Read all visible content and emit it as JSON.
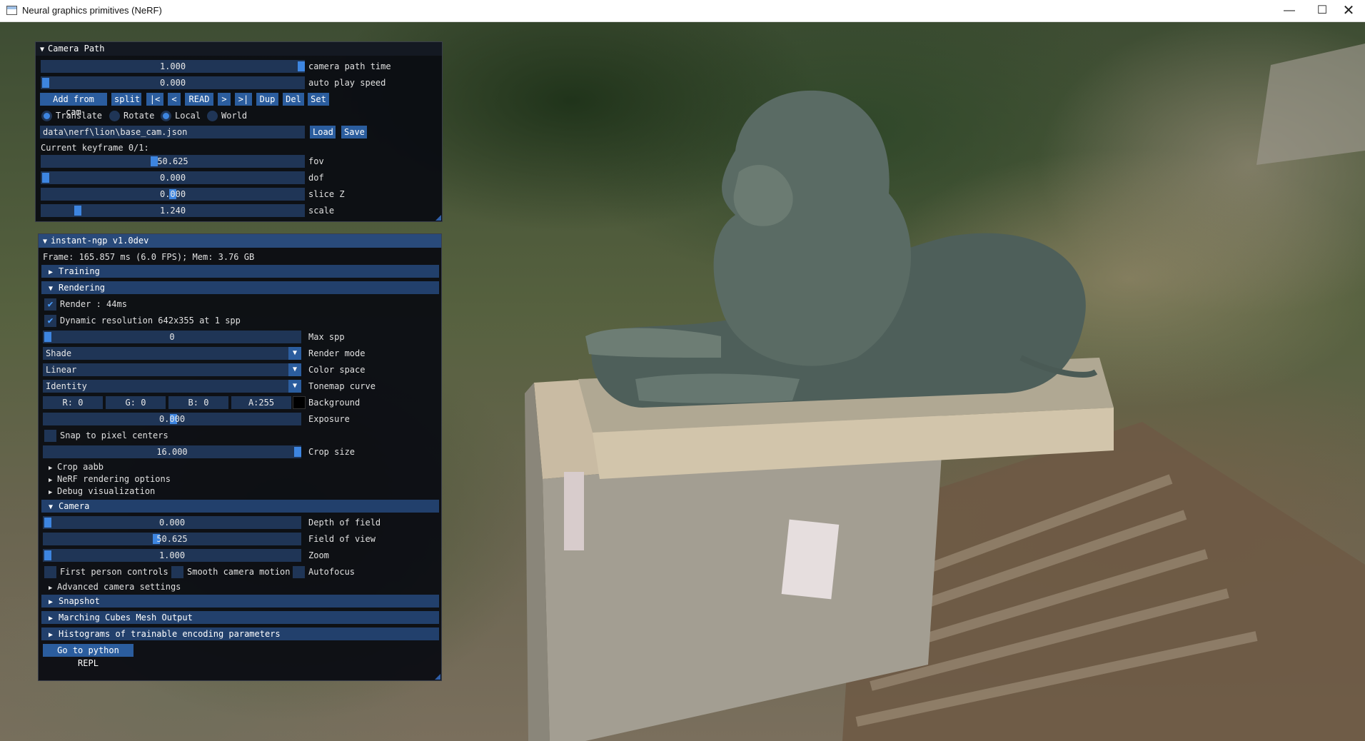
{
  "window": {
    "title": "Neural graphics primitives (NeRF)",
    "minimize": "—",
    "maximize": "☐",
    "close": "✕"
  },
  "camera_path": {
    "title": "Camera Path",
    "path_time": {
      "value": "1.000",
      "label": "camera path time",
      "fraction": 1.0
    },
    "play_speed": {
      "value": "0.000",
      "label": "auto play speed",
      "fraction": 0.0
    },
    "buttons": [
      "Add from cam",
      "split",
      "|<",
      "<",
      "READ",
      ">",
      ">|",
      "Dup",
      "Del",
      "Set"
    ],
    "radios": [
      {
        "label": "Translate",
        "selected": true
      },
      {
        "label": "Rotate",
        "selected": false
      },
      {
        "label": "Local",
        "selected": true
      },
      {
        "label": "World",
        "selected": false
      }
    ],
    "file_path": "data\\nerf\\lion\\base_cam.json",
    "load_label": "Load",
    "save_label": "Save",
    "keyframe_text": "Current keyframe 0/1:",
    "fov": {
      "value": "50.625",
      "label": "fov"
    },
    "dof": {
      "value": "0.000",
      "label": "dof"
    },
    "slice_z": {
      "value": "0.000",
      "label": "slice Z"
    },
    "scale": {
      "value": "1.240",
      "label": "scale"
    }
  },
  "ngp": {
    "title": "instant-ngp v1.0dev",
    "frame_stats": "Frame: 165.857 ms (6.0 FPS); Mem: 3.76 GB",
    "sections": {
      "training": "Training",
      "rendering": "Rendering",
      "camera": "Camera",
      "snapshot": "Snapshot",
      "marching": "Marching Cubes Mesh Output",
      "histograms": "Histograms of trainable encoding parameters"
    },
    "render_check": "Render : 44ms",
    "dynamic_res": "Dynamic resolution 642x355 at 1 spp",
    "max_spp": {
      "value": "0",
      "label": "Max spp"
    },
    "render_mode": {
      "value": "Shade",
      "label": "Render mode"
    },
    "color_space": {
      "value": "Linear",
      "label": "Color space"
    },
    "tonemap": {
      "value": "Identity",
      "label": "Tonemap curve"
    },
    "background": {
      "r": "R:  0",
      "g": "G:  0",
      "b": "B:  0",
      "a": "A:255",
      "label": "Background",
      "color": "#000000"
    },
    "exposure": {
      "value": "0.000",
      "label": "Exposure"
    },
    "snap_pixel": "Snap to pixel centers",
    "crop_size": {
      "value": "16.000",
      "label": "Crop size"
    },
    "tree_items": [
      "Crop aabb",
      "NeRF rendering options",
      "Debug visualization"
    ],
    "depth_of_field": {
      "value": "0.000",
      "label": "Depth of field"
    },
    "field_of_view": {
      "value": "50.625",
      "label": "Field of view"
    },
    "zoom": {
      "value": "1.000",
      "label": "Zoom"
    },
    "first_person": "First person controls",
    "smooth_motion": "Smooth camera motion",
    "autofocus": "Autofocus",
    "advanced_camera": "Advanced camera settings",
    "python_repl": "Go to python REPL"
  },
  "colors": {
    "title_bar": "#294a7a",
    "frame_bg": "#1f3556",
    "button": "#2b5d9e",
    "accent": "#3d85e0"
  }
}
